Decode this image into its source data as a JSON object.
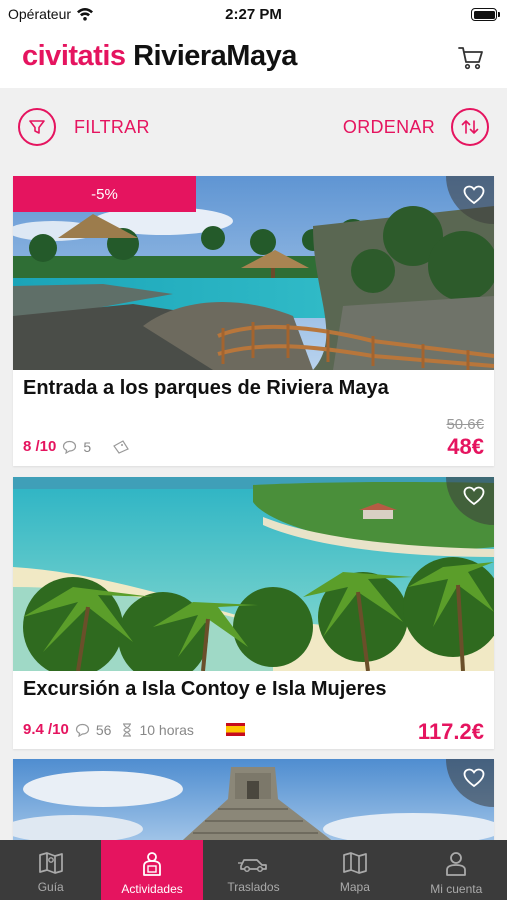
{
  "status_bar": {
    "carrier": "Opérateur",
    "time": "2:27 PM"
  },
  "header": {
    "brand": "civitatis",
    "destination": "RivieraMaya",
    "cart_icon": "cart-icon",
    "brand_color": "#e5145f"
  },
  "toolbar": {
    "filter_label": "FILTRAR",
    "order_label": "ORDENAR"
  },
  "cards": [
    {
      "discount": "-5%",
      "title": "Entrada a los parques de Riviera Maya",
      "rating": "8 /10",
      "reviews": "5",
      "old_price": "50.6€",
      "price": "48€",
      "favorited": false
    },
    {
      "title": "Excursión a Isla Contoy e Isla Mujeres",
      "rating": "9.4 /10",
      "reviews": "56",
      "duration": "10 horas",
      "language_flag": "spain-flag",
      "price": "117.2€",
      "favorited": false
    },
    {
      "favorited": false
    }
  ],
  "tabs": [
    {
      "label": "Guía",
      "icon": "map-guide-icon",
      "active": false
    },
    {
      "label": "Actividades",
      "icon": "activities-icon",
      "active": true
    },
    {
      "label": "Traslados",
      "icon": "transfer-car-icon",
      "active": false
    },
    {
      "label": "Mapa",
      "icon": "map-icon",
      "active": false
    },
    {
      "label": "Mi cuenta",
      "icon": "user-icon",
      "active": false
    }
  ]
}
